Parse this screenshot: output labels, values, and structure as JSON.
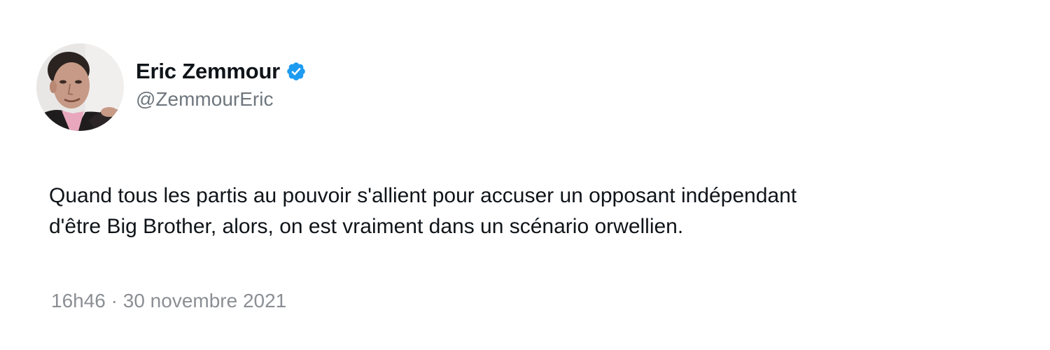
{
  "author": {
    "display_name": "Eric Zemmour",
    "handle": "@ZemmourEric",
    "verified": true,
    "verified_color": "#1d9bf0"
  },
  "tweet": {
    "text_line_1": "Quand tous les partis au pouvoir s'allient pour accuser un opposant indépendant",
    "text_line_2": "d'être Big Brother, alors, on est vraiment dans un scénario orwellien.",
    "timestamp": "16h46 · 30 novembre 2021"
  },
  "colors": {
    "text_primary": "#0f1419",
    "text_secondary": "#6e767d",
    "background": "#ffffff"
  },
  "icons": {
    "verified": "verified-badge-icon",
    "avatar": "profile-photo"
  }
}
